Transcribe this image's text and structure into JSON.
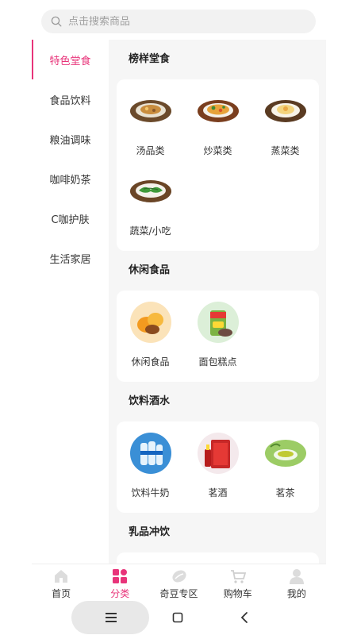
{
  "search": {
    "placeholder": "点击搜索商品"
  },
  "sidebar": {
    "items": [
      {
        "label": "特色堂食",
        "active": true
      },
      {
        "label": "食品饮料"
      },
      {
        "label": "粮油调味"
      },
      {
        "label": "咖啡奶茶"
      },
      {
        "label": "C咖护肤"
      },
      {
        "label": "生活家居"
      }
    ]
  },
  "sections": [
    {
      "title": "榜样堂食",
      "items": [
        {
          "label": "汤品类",
          "icon": "soup-dish-icon"
        },
        {
          "label": "炒菜类",
          "icon": "stir-fry-dish-icon"
        },
        {
          "label": "蒸菜类",
          "icon": "steamed-dish-icon"
        },
        {
          "label": "蔬菜/小吃",
          "icon": "vegetable-dish-icon"
        }
      ]
    },
    {
      "title": "休闲食品",
      "items": [
        {
          "label": "休闲食品",
          "icon": "snack-icon"
        },
        {
          "label": "面包糕点",
          "icon": "chips-can-icon"
        }
      ]
    },
    {
      "title": "饮料酒水",
      "items": [
        {
          "label": "饮料牛奶",
          "icon": "water-bottles-icon"
        },
        {
          "label": "茗酒",
          "icon": "liquor-box-icon"
        },
        {
          "label": "茗茶",
          "icon": "tea-cup-icon"
        }
      ]
    },
    {
      "title": "乳品冲饮",
      "items": [
        {
          "label": "",
          "icon": "milk-powder-icon"
        }
      ]
    }
  ],
  "tabbar": {
    "items": [
      {
        "label": "首页",
        "icon": "home-icon"
      },
      {
        "label": "分类",
        "icon": "category-icon",
        "active": true
      },
      {
        "label": "奇豆专区",
        "icon": "bean-icon"
      },
      {
        "label": "购物车",
        "icon": "cart-icon"
      },
      {
        "label": "我的",
        "icon": "profile-icon"
      }
    ]
  },
  "colors": {
    "accent": "#e8347a",
    "background": "#f6f6f6"
  }
}
